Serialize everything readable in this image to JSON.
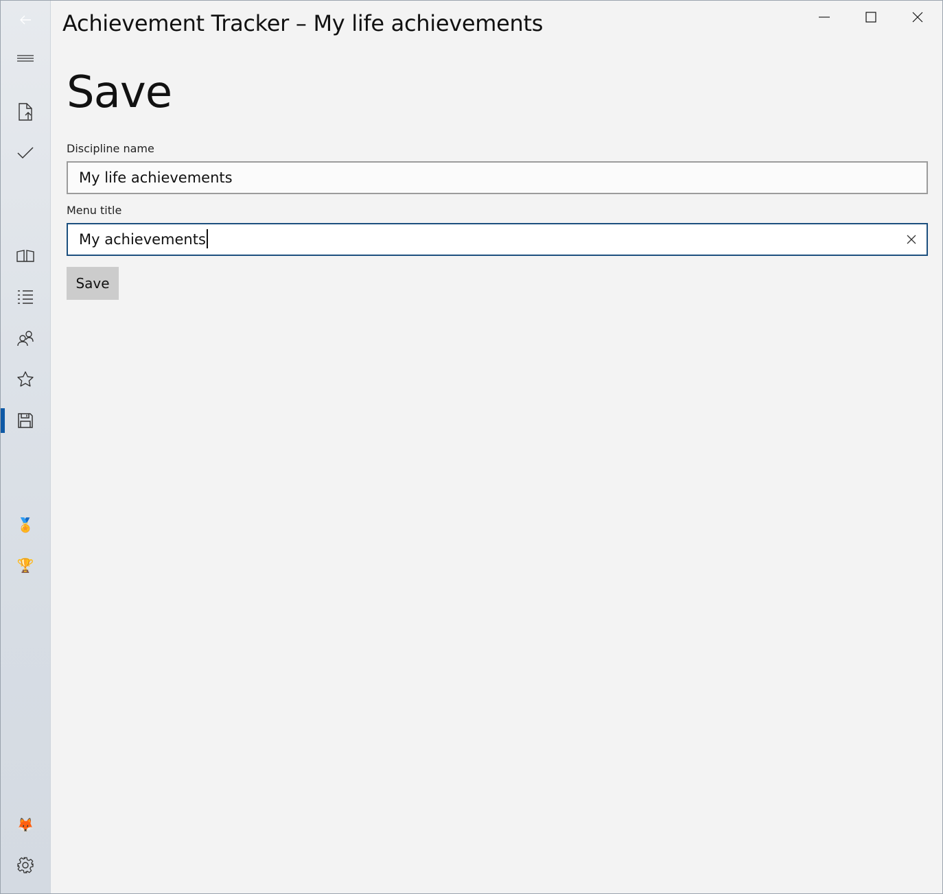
{
  "window": {
    "title": "Achievement Tracker – My life achievements"
  },
  "sidebar": {
    "items": [
      {
        "name": "back",
        "icon": "back-arrow-icon"
      },
      {
        "name": "menu",
        "icon": "hamburger-icon"
      },
      {
        "name": "open-file",
        "icon": "file-upload-icon"
      },
      {
        "name": "check",
        "icon": "checkmark-icon"
      },
      {
        "name": "library",
        "icon": "book-icon"
      },
      {
        "name": "list",
        "icon": "list-icon"
      },
      {
        "name": "people",
        "icon": "people-icon"
      },
      {
        "name": "favorites",
        "icon": "star-icon"
      },
      {
        "name": "save",
        "icon": "save-disk-icon",
        "active": true
      },
      {
        "name": "medal",
        "icon": "medal-icon",
        "glyph": "🏅"
      },
      {
        "name": "trophy",
        "icon": "trophy-icon",
        "glyph": "🏆"
      },
      {
        "name": "profile",
        "icon": "fox-avatar-icon",
        "glyph": "🦊"
      },
      {
        "name": "settings",
        "icon": "gear-icon"
      }
    ]
  },
  "page": {
    "title": "Save",
    "discipline_label": "Discipline name",
    "discipline_value": "My life achievements",
    "menu_title_label": "Menu title",
    "menu_title_value": "My achievements",
    "save_label": "Save"
  },
  "colors": {
    "accent": "#0f5aa6",
    "focus_border": "#1b4f7e",
    "button_bg": "#cccccc",
    "page_bg": "#f3f3f3"
  }
}
